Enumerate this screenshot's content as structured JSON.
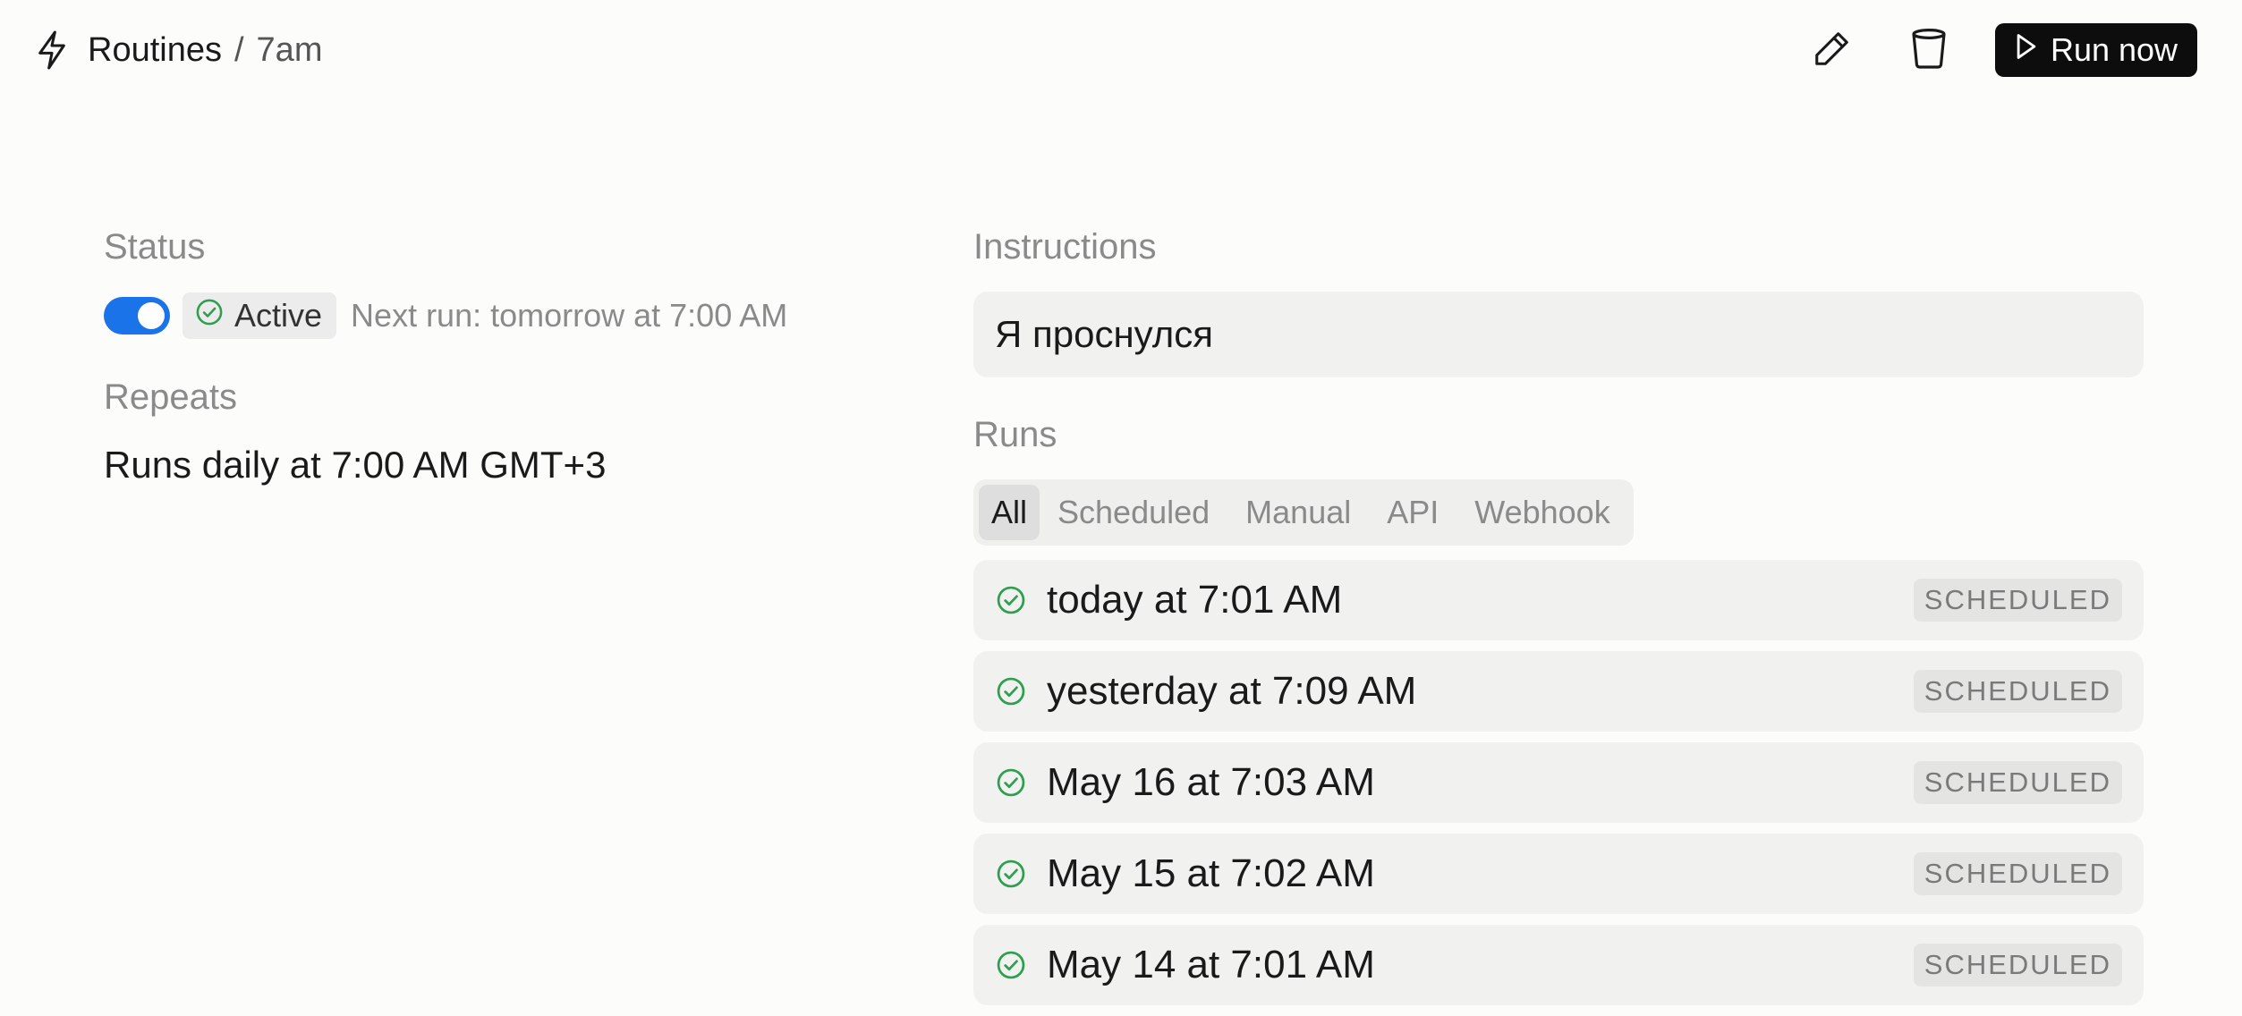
{
  "header": {
    "breadcrumb_root": "Routines",
    "breadcrumb_sep": "/",
    "breadcrumb_current": "7am",
    "run_now_label": "Run now"
  },
  "status": {
    "label": "Status",
    "enabled": true,
    "badge": "Active",
    "next_run": "Next run: tomorrow at 7:00 AM"
  },
  "repeats": {
    "label": "Repeats",
    "value": "Runs daily at 7:00 AM GMT+3"
  },
  "instructions": {
    "label": "Instructions",
    "value": "Я проснулся"
  },
  "runs": {
    "label": "Runs",
    "filters": [
      "All",
      "Scheduled",
      "Manual",
      "API",
      "Webhook"
    ],
    "selected_filter": "All",
    "items": [
      {
        "time": "today at 7:01 AM",
        "badge": "SCHEDULED"
      },
      {
        "time": "yesterday at 7:09 AM",
        "badge": "SCHEDULED"
      },
      {
        "time": "May 16 at 7:03 AM",
        "badge": "SCHEDULED"
      },
      {
        "time": "May 15 at 7:02 AM",
        "badge": "SCHEDULED"
      },
      {
        "time": "May 14 at 7:01 AM",
        "badge": "SCHEDULED"
      }
    ]
  },
  "colors": {
    "accent": "#1a73e8",
    "success": "#2e9e4f",
    "primary_button": "#0d0d0d"
  },
  "icons": {
    "breadcrumb": "lightning-bolt-icon",
    "edit": "pencil-icon",
    "delete": "trash-can-icon",
    "run": "play-icon",
    "status": "check-circle-icon"
  }
}
